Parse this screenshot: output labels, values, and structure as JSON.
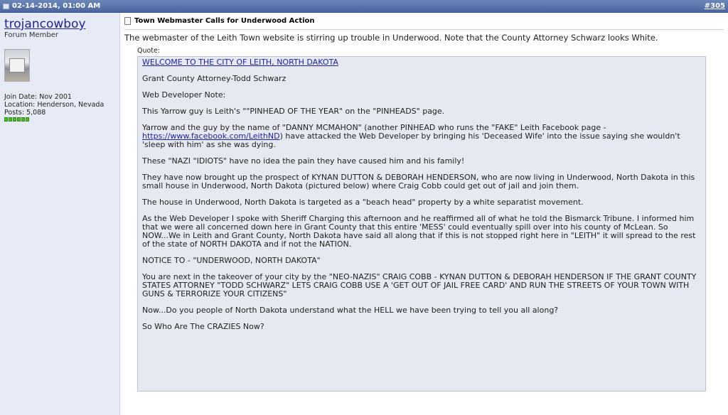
{
  "header": {
    "date": "02-14-2014, 01:00 AM",
    "post_number": "#305"
  },
  "user": {
    "name": "trojancowboy",
    "title": "Forum Member",
    "join_date": "Join Date: Nov 2001",
    "location": "Location: Henderson, Nevada",
    "posts": "Posts: 5,088"
  },
  "post": {
    "title": "Town Webmaster Calls for Underwood Action",
    "intro": "The webmaster of the Leith Town website is stirring up trouble in Underwood. Note that the County Attorney Schwarz looks White.",
    "quote_label": "Quote:",
    "quote_link": "WELCOME TO THE CITY OF LEITH, NORTH DAKOTA",
    "p1": "Grant County Attorney-Todd Schwarz",
    "p2": "Web Developer Note:",
    "p3": "This Yarrow guy is Leith's \"\"PINHEAD OF THE YEAR\" on the \"PINHEADS\" page.",
    "p4a": "Yarrow and the guy by the name of \"DANNY MCMAHON\" (another PINHEAD who runs the \"FAKE\" Leith Facebook page - ",
    "p4_link": "https://www.facebook.com/LeithND",
    "p4b": ") have attacked the Web Developer by bringing his 'Deceased Wife' into the issue saying she wouldn't 'sleep with him' as she was dying.",
    "p5": "These \"NAZI \"IDIOTS\" have no idea the pain they have caused him and his family!",
    "p6": "They have now brought up the prospect of KYNAN DUTTON & DEBORAH HENDERSON, who are now living in Underwood, North Dakota in this small house in Underwood, North Dakota (pictured below) where Craig Cobb could get out of jail and join them.",
    "p7": "The house in Underwood, North Dakota is targeted as a \"beach head\" property by a white separatist movement.",
    "p8": "As the Web Developer I spoke with Sheriff Charging this afternoon and he reaffirmed all of what he told the Bismarck Tribune. I informed him that we were all concerned down here in Grant County that this entire 'MESS' could eventually spill over into his county of McLean. So NOW...We in Leith and Grant County, North Dakota have said all along that if this is not stopped right here in \"LEITH\" it will spread to the rest of the state of NORTH DAKOTA and if not the NATION.",
    "p9": "NOTICE TO - \"UNDERWOOD, NORTH DAKOTA\"",
    "p10": "You are next in the takeover of your city by the \"NEO-NAZIS\" CRAIG COBB - KYNAN DUTTON & DEBORAH HENDERSON IF THE GRANT COUNTY STATES ATTORNEY \"TODD SCHWARZ\" LETS CRAIG COBB USE A 'GET OUT OF JAIL FREE CARD' AND RUN THE STREETS OF YOUR TOWN WITH GUNS & TERRORIZE YOUR CITIZENS\"",
    "p11": "Now...Do you people of North Dakota understand what the HELL we have been trying to tell you all along?",
    "p12": "So Who Are The CRAZIES Now?"
  }
}
